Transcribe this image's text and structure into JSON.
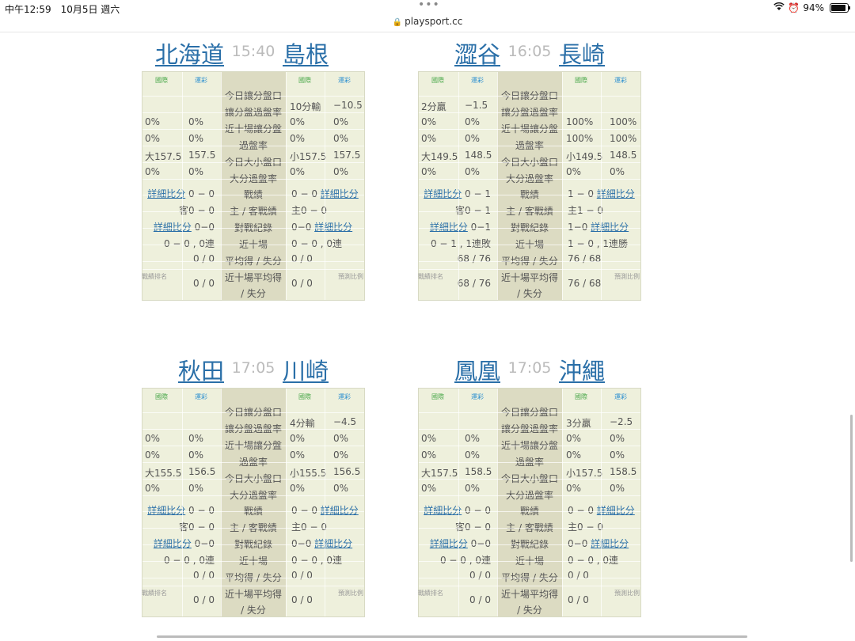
{
  "status_bar": {
    "time": "中午12:59　10月5日 週六",
    "url": "playsport.cc",
    "battery": "94%"
  },
  "labels": {
    "brand_intl": "國際",
    "brand_sport": "運彩",
    "row_today_spread": "今日讓分盤口",
    "row_spread_rate": "讓分盤過盤率",
    "row_last10_spread_rate_1": "近十場讓分盤",
    "row_last10_spread_rate_2": "過盤率",
    "row_today_total": "今日大小盤口",
    "row_over_rate": "大分過盤率",
    "row_record": "戰績",
    "row_home_away": "主 / 客戰績",
    "row_h2h": "對戰紀錄",
    "row_last10": "近十場",
    "row_avg": "平均得 / 失分",
    "row_last10_avg_1": "近十場平均得",
    "row_last10_avg_2": "/ 失分",
    "detail_link": "詳細比分",
    "footer_rank": "戰績排名",
    "footer_predict": "預測比例"
  },
  "matches": [
    {
      "away": "北海道",
      "time": "15:40",
      "home": "島根",
      "away_spread_intl": "",
      "away_spread_sport": "",
      "home_spread_intl": "10分輸",
      "home_spread_sport": "−10.5",
      "away_rate_intl": "0%",
      "away_rate_sport": "0%",
      "home_rate_intl": "0%",
      "home_rate_sport": "0%",
      "away_l10_intl": "0%",
      "away_l10_sport": "0%",
      "home_l10_intl": "0%",
      "home_l10_sport": "0%",
      "away_total_intl": "大157.5",
      "away_total_sport": "157.5",
      "home_total_intl": "小157.5",
      "home_total_sport": "157.5",
      "away_over_intl": "0%",
      "away_over_sport": "0%",
      "home_over_intl": "0%",
      "home_over_sport": "0%",
      "away_record": "0 − 0",
      "home_record": "0 − 0",
      "away_ha": "客0 − 0",
      "home_ha": "主0 − 0",
      "away_h2h": "0−0",
      "home_h2h": "0−0",
      "away_last10": "0 − 0 , 0連",
      "home_last10": "0 − 0 , 0連",
      "away_avg": "0 / 0",
      "home_avg": "0 / 0",
      "away_l10avg": "0 / 0",
      "home_l10avg": "0 / 0"
    },
    {
      "away": "澀谷",
      "time": "16:05",
      "home": "長崎",
      "away_spread_intl": "2分贏",
      "away_spread_sport": "−1.5",
      "home_spread_intl": "",
      "home_spread_sport": "",
      "away_rate_intl": "0%",
      "away_rate_sport": "0%",
      "home_rate_intl": "100%",
      "home_rate_sport": "100%",
      "away_l10_intl": "0%",
      "away_l10_sport": "0%",
      "home_l10_intl": "100%",
      "home_l10_sport": "100%",
      "away_total_intl": "大149.5",
      "away_total_sport": "148.5",
      "home_total_intl": "小149.5",
      "home_total_sport": "148.5",
      "away_over_intl": "0%",
      "away_over_sport": "0%",
      "home_over_intl": "0%",
      "home_over_sport": "0%",
      "away_record": "0 − 1",
      "home_record": "1 − 0",
      "away_ha": "客0 − 1",
      "home_ha": "主1 − 0",
      "away_h2h": "0−1",
      "home_h2h": "1−0",
      "away_last10": "0 − 1 , 1連敗",
      "home_last10": "1 − 0 , 1連勝",
      "away_avg": "68 / 76",
      "home_avg": "76 / 68",
      "away_l10avg": "68 / 76",
      "home_l10avg": "76 / 68"
    },
    {
      "away": "秋田",
      "time": "17:05",
      "home": "川崎",
      "away_spread_intl": "",
      "away_spread_sport": "",
      "home_spread_intl": "4分輸",
      "home_spread_sport": "−4.5",
      "away_rate_intl": "0%",
      "away_rate_sport": "0%",
      "home_rate_intl": "0%",
      "home_rate_sport": "0%",
      "away_l10_intl": "0%",
      "away_l10_sport": "0%",
      "home_l10_intl": "0%",
      "home_l10_sport": "0%",
      "away_total_intl": "大155.5",
      "away_total_sport": "156.5",
      "home_total_intl": "小155.5",
      "home_total_sport": "156.5",
      "away_over_intl": "0%",
      "away_over_sport": "0%",
      "home_over_intl": "0%",
      "home_over_sport": "0%",
      "away_record": "0 − 0",
      "home_record": "0 − 0",
      "away_ha": "客0 − 0",
      "home_ha": "主0 − 0",
      "away_h2h": "0−0",
      "home_h2h": "0−0",
      "away_last10": "0 − 0 , 0連",
      "home_last10": "0 − 0 , 0連",
      "away_avg": "0 / 0",
      "home_avg": "0 / 0",
      "away_l10avg": "0 / 0",
      "home_l10avg": "0 / 0"
    },
    {
      "away": "鳳凰",
      "time": "17:05",
      "home": "沖繩",
      "away_spread_intl": "",
      "away_spread_sport": "",
      "home_spread_intl": "3分贏",
      "home_spread_sport": "−2.5",
      "away_rate_intl": "0%",
      "away_rate_sport": "0%",
      "home_rate_intl": "0%",
      "home_rate_sport": "0%",
      "away_l10_intl": "0%",
      "away_l10_sport": "0%",
      "home_l10_intl": "0%",
      "home_l10_sport": "0%",
      "away_total_intl": "大157.5",
      "away_total_sport": "158.5",
      "home_total_intl": "小157.5",
      "home_total_sport": "158.5",
      "away_over_intl": "0%",
      "away_over_sport": "0%",
      "home_over_intl": "0%",
      "home_over_sport": "0%",
      "away_record": "0 − 0",
      "home_record": "0 − 0",
      "away_ha": "客0 − 0",
      "home_ha": "主0 − 0",
      "away_h2h": "0−0",
      "home_h2h": "0−0",
      "away_last10": "0 − 0 , 0連",
      "home_last10": "0 − 0 , 0連",
      "away_avg": "0 / 0",
      "home_avg": "0 / 0",
      "away_l10avg": "0 / 0",
      "home_l10avg": "0 / 0"
    }
  ]
}
